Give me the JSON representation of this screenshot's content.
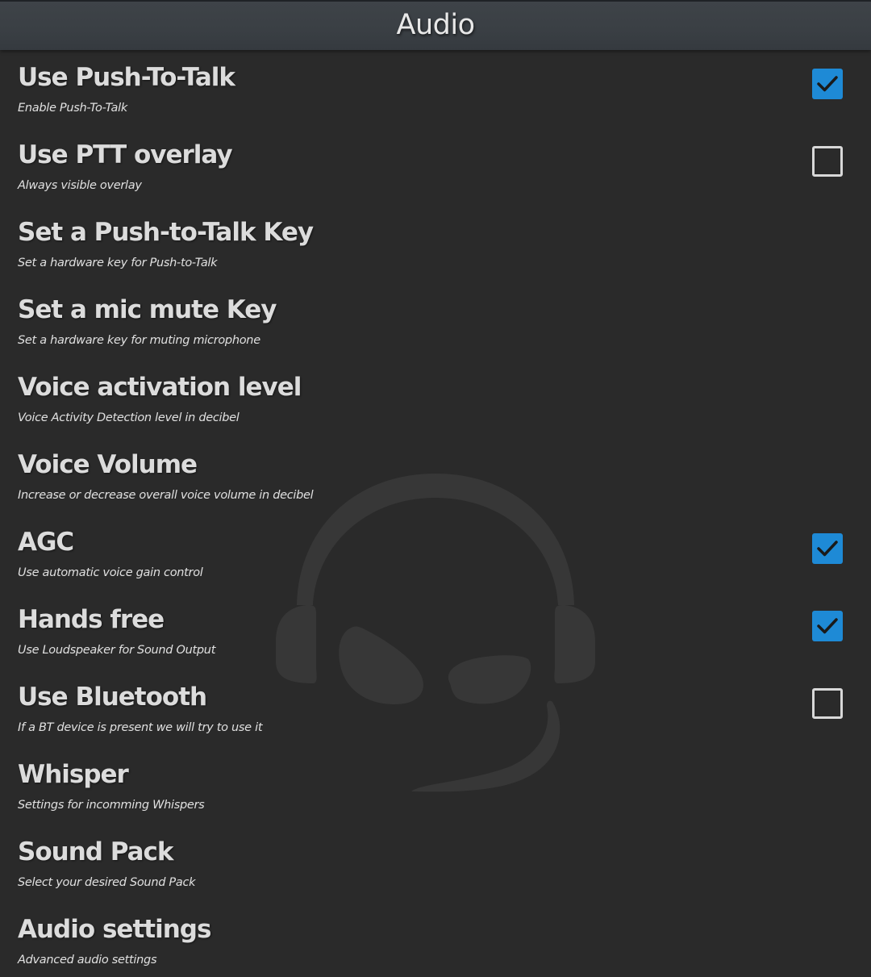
{
  "header": {
    "title": "Audio"
  },
  "settings": [
    {
      "title": "Use Push-To-Talk",
      "subtitle": "Enable Push-To-Talk",
      "has_checkbox": true,
      "checked": true
    },
    {
      "title": "Use PTT overlay",
      "subtitle": "Always visible overlay",
      "has_checkbox": true,
      "checked": false
    },
    {
      "title": "Set a Push-to-Talk Key",
      "subtitle": "Set a hardware key for Push-to-Talk",
      "has_checkbox": false,
      "checked": false
    },
    {
      "title": "Set a mic mute Key",
      "subtitle": "Set a hardware key for muting microphone",
      "has_checkbox": false,
      "checked": false
    },
    {
      "title": "Voice activation level",
      "subtitle": "Voice Activity Detection level in decibel",
      "has_checkbox": false,
      "checked": false
    },
    {
      "title": "Voice Volume",
      "subtitle": "Increase or decrease overall voice volume in decibel",
      "has_checkbox": false,
      "checked": false
    },
    {
      "title": "AGC",
      "subtitle": "Use automatic voice gain control",
      "has_checkbox": true,
      "checked": true
    },
    {
      "title": "Hands free",
      "subtitle": "Use Loudspeaker for Sound Output",
      "has_checkbox": true,
      "checked": true
    },
    {
      "title": "Use Bluetooth",
      "subtitle": "If a BT device is present we will try to use it",
      "has_checkbox": true,
      "checked": false
    },
    {
      "title": "Whisper",
      "subtitle": "Settings for incomming Whispers",
      "has_checkbox": false,
      "checked": false
    },
    {
      "title": "Sound Pack",
      "subtitle": "Select your desired Sound Pack",
      "has_checkbox": false,
      "checked": false
    },
    {
      "title": "Audio settings",
      "subtitle": "Advanced audio settings",
      "has_checkbox": false,
      "checked": false
    }
  ],
  "watermark": {
    "icon": "headset-logo-icon"
  },
  "colors": {
    "background": "#2a2a2a",
    "header": "#3a3f44",
    "checkbox_checked": "#1e8ad6",
    "checkbox_border": "#d8d8d8",
    "text": "#dcdcdc"
  }
}
